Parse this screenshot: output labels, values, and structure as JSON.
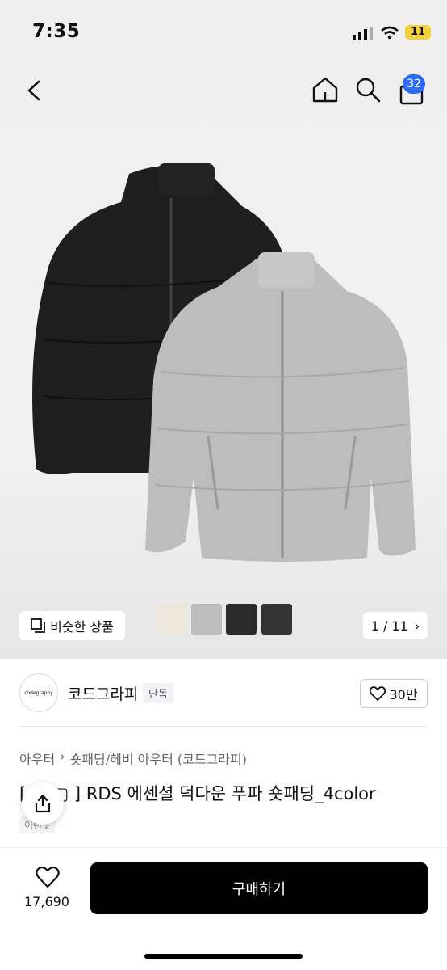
{
  "status_bar": {
    "time": "7:35",
    "battery": "11"
  },
  "header": {
    "cart_count": "32",
    "icons": [
      "back-arrow-icon",
      "home-icon",
      "search-icon",
      "cart-icon"
    ]
  },
  "gallery": {
    "similar_label": "비슷한 상품",
    "page_indicator": "1 / 11",
    "swatches": [
      "#ece7da",
      "#bdbdbd",
      "#2a2a2a",
      "#333333"
    ]
  },
  "shop": {
    "logo_text": "codegraphy",
    "name": "코드그라피",
    "badge": "단독",
    "likes": "30만"
  },
  "product": {
    "breadcrumb": [
      "아우터",
      "숏패딩/헤비 아우터 (코드그라피)"
    ],
    "title": "[ ▢ ▢ ] RDS 에센셜 덕다운 푸파 숏패딩_4color",
    "title_visible": "O] RDS 에센셜 덕다운 푸파 숏패딩_4color",
    "tag": "이런옷"
  },
  "bottom": {
    "wish_count": "17,690",
    "buy_label": "구매하기"
  },
  "colors": {
    "accent": "#2f6bf5",
    "buy": "#000000"
  }
}
